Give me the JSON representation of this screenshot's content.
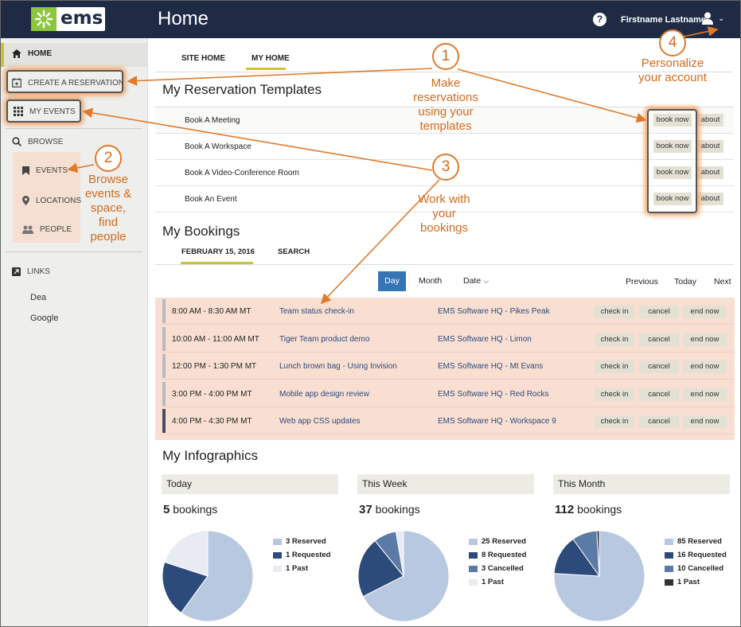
{
  "header": {
    "logo_text": "ems",
    "title": "Home",
    "help": "?",
    "user_name": "Firstname Lastname",
    "user_chevron": "⌄"
  },
  "sidebar": {
    "home": "HOME",
    "create_reservation": "CREATE A RESERVATION",
    "my_events": "MY EVENTS",
    "browse": "BROWSE",
    "events": "EVENTS",
    "locations": "LOCATIONS",
    "people": "PEOPLE",
    "links": "LINKS",
    "link_items": [
      "Dea",
      "Google"
    ]
  },
  "tabs": {
    "site_home": "SITE HOME",
    "my_home": "MY HOME"
  },
  "templates": {
    "title": "My Reservation Templates",
    "rows": [
      "Book A Meeting",
      "Book A Workspace",
      "Book A Video-Conference Room",
      "Book An Event"
    ],
    "book_label": "book now",
    "about_label": "about"
  },
  "bookings": {
    "title": "My Bookings",
    "tab_date": "FEBRUARY 15, 2016",
    "tab_search": "SEARCH",
    "view_day": "Day",
    "view_month": "Month",
    "view_date": "Date",
    "prev": "Previous",
    "today": "Today",
    "next": "Next",
    "checkin_label": "check in",
    "cancel_label": "cancel",
    "endnow_label": "end now",
    "rows": [
      {
        "time": "8:00 AM - 8:30 AM MT",
        "title": "Team status check-in",
        "location": "EMS Software HQ - Pikes Peak"
      },
      {
        "time": "10:00 AM - 11:00 AM MT",
        "title": "Tiger Team product demo",
        "location": "EMS Software HQ - Limon"
      },
      {
        "time": "12:00 PM - 1:30 PM MT",
        "title": "Lunch brown bag - Using Invision",
        "location": "EMS Software HQ - Mt Evans"
      },
      {
        "time": "3:00 PM - 4:00 PM MT",
        "title": "Mobile app design review",
        "location": "EMS Software HQ - Red Rocks"
      },
      {
        "time": "4:00 PM - 4:30 PM MT",
        "title": "Web app CSS updates",
        "location": "EMS Software HQ - Workspace 9"
      }
    ]
  },
  "infographics": {
    "title": "My Infographics",
    "bookings_word": "bookings",
    "panels": [
      {
        "heading": "Today",
        "count": "5",
        "legend": [
          "3 Reserved",
          "1 Requested",
          "1 Past"
        ],
        "values": [
          3,
          1,
          1
        ],
        "colors": [
          "#b7c8e0",
          "#2c4a7a",
          "#e8ebf2"
        ]
      },
      {
        "heading": "This Week",
        "count": "37",
        "legend": [
          "25 Reserved",
          "8 Requested",
          "3 Cancelled",
          "1 Past"
        ],
        "values": [
          25,
          8,
          3,
          1
        ],
        "colors": [
          "#b7c8e0",
          "#2c4a7a",
          "#5c7aa6",
          "#e8ebf2"
        ]
      },
      {
        "heading": "This Month",
        "count": "112",
        "legend": [
          "85 Reserved",
          "16 Requested",
          "10 Cancelled",
          "1 Past"
        ],
        "values": [
          85,
          16,
          10,
          1
        ],
        "colors": [
          "#b7c8e0",
          "#2c4a7a",
          "#5c7aa6",
          "#333333"
        ]
      }
    ]
  },
  "callouts": {
    "c1_num": "1",
    "c1_text": "Make reservations using your templates",
    "c2_num": "2",
    "c2_text": "Browse events & space, find people",
    "c3_num": "3",
    "c3_text": "Work with your bookings",
    "c4_num": "4",
    "c4_text": "Personalize your account"
  },
  "colors": {
    "accent": "#c9c436",
    "topbar": "#1f2b45",
    "callout": "#e07a2a",
    "brand_green": "#8cc63f",
    "day_button": "#3575b6"
  }
}
